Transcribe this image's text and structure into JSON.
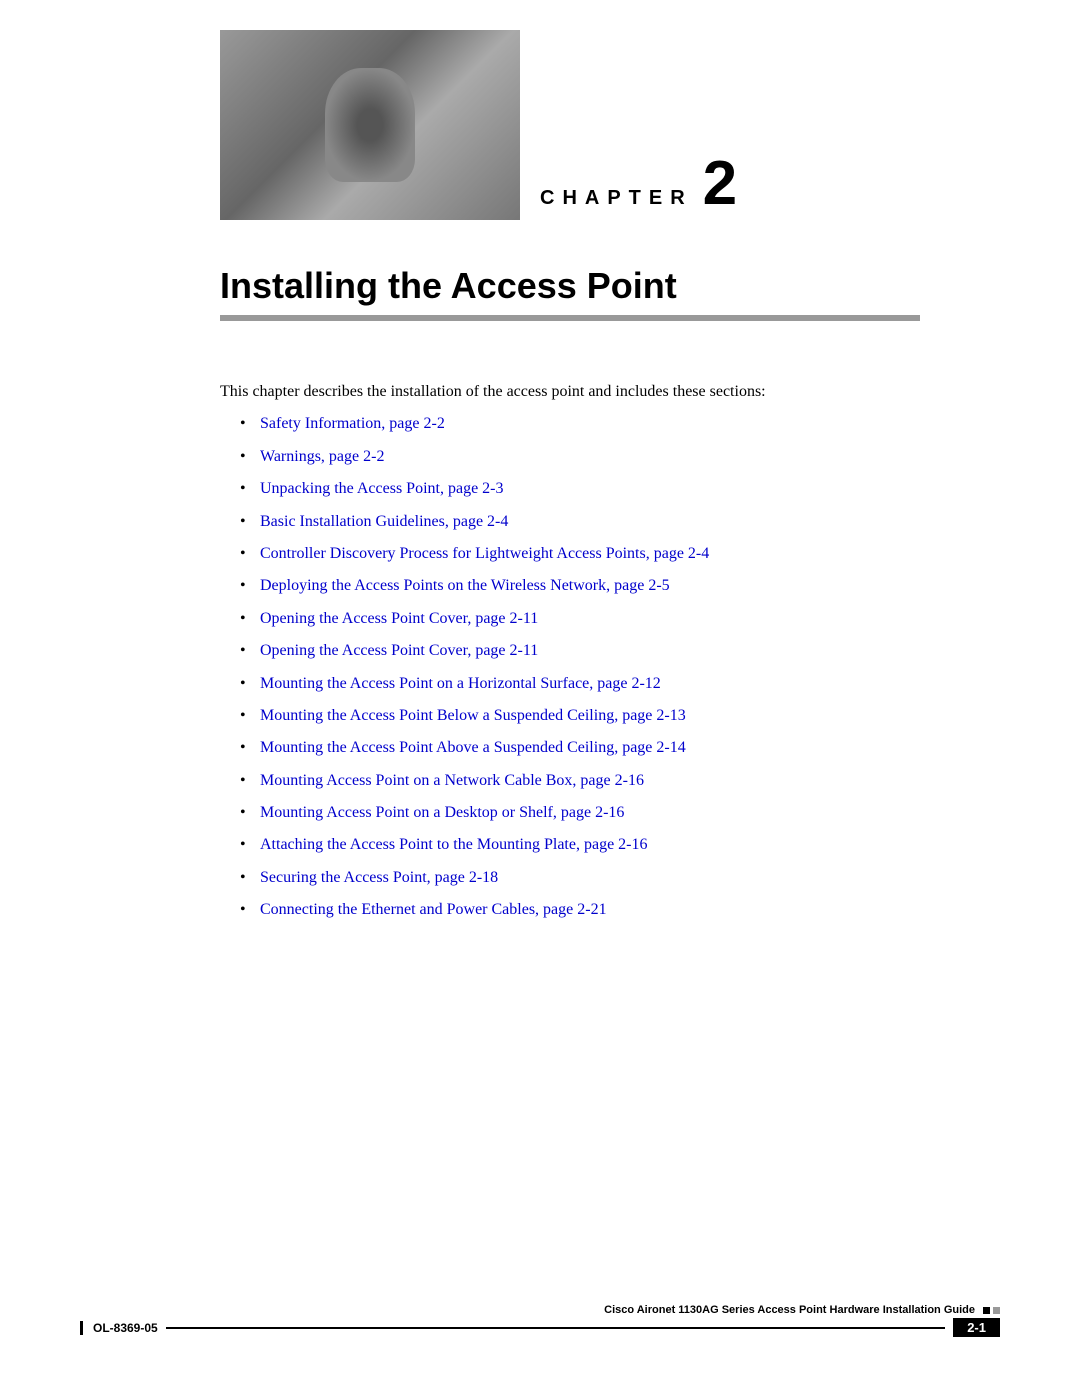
{
  "chapter": {
    "label": "CHAPTER",
    "number": "2",
    "title": "Installing the Access Point"
  },
  "intro": "This chapter describes the installation of the access point and includes these sections:",
  "links": [
    "Safety Information, page 2-2",
    "Warnings, page 2-2",
    "Unpacking the Access Point, page 2-3",
    "Basic Installation Guidelines, page 2-4",
    "Controller Discovery Process for Lightweight Access Points, page 2-4",
    "Deploying the Access Points on the Wireless Network, page 2-5",
    "Opening the Access Point Cover, page 2-11",
    "Opening the Access Point Cover, page 2-11",
    "Mounting the Access Point on a Horizontal Surface, page 2-12",
    "Mounting the Access Point Below a Suspended Ceiling, page 2-13",
    "Mounting the Access Point Above a Suspended Ceiling, page 2-14",
    "Mounting Access Point on a Network Cable Box, page 2-16",
    "Mounting Access Point on a Desktop or Shelf, page 2-16",
    "Attaching the Access Point to the Mounting Plate, page 2-16",
    "Securing the Access Point, page 2-18",
    "Connecting the Ethernet and Power Cables, page 2-21"
  ],
  "footer": {
    "doc_title": "Cisco Aironet 1130AG Series Access Point Hardware Installation Guide",
    "doc_id": "OL-8369-05",
    "page_number": "2-1"
  }
}
